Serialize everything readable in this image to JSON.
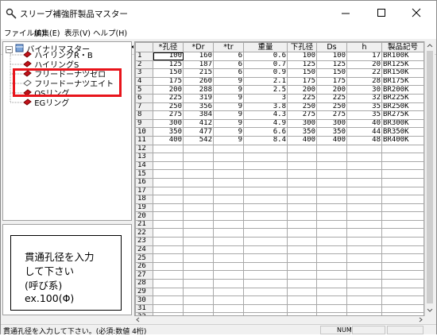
{
  "window": {
    "title": "スリーブ補強肝製品マスター",
    "buttons": [
      "minimize-button",
      "maximize-button",
      "close-button"
    ]
  },
  "menu": [
    {
      "label": "ファイル(F)"
    },
    {
      "label": "編集(E)"
    },
    {
      "label": "表示(V)"
    },
    {
      "label": "ヘルプ(H)"
    }
  ],
  "toolbar": {
    "icons": [
      "open-icon",
      "save-icon",
      "undo-icon",
      "redo-icon",
      "cut-icon",
      "copy-icon",
      "paste-icon",
      "insert-row-icon",
      "delete-row-icon",
      "help-icon"
    ]
  },
  "tree": {
    "root": {
      "label": "バイナリマスター",
      "expander": "−"
    },
    "items": [
      {
        "label": "ハイリングR・B"
      },
      {
        "label": "ハイリングS"
      },
      {
        "label": "フリードーナツゼロ"
      },
      {
        "label": "フリードーナツエイト"
      },
      {
        "label": "OSリング"
      },
      {
        "label": "EGリング"
      }
    ]
  },
  "info": {
    "lines": [
      "貫通孔径を入力",
      "して下さい",
      "(呼び系)",
      "ex.100(Φ)"
    ]
  },
  "grid": {
    "columns": [
      "*孔径",
      "*Dr",
      "*tr",
      "重量",
      "下孔径",
      "Ds",
      "h",
      "製品記号"
    ],
    "rows": [
      [
        "100",
        "160",
        "6",
        "0.6",
        "100",
        "100",
        "17",
        "BR100K"
      ],
      [
        "125",
        "187",
        "6",
        "0.7",
        "125",
        "125",
        "20",
        "BR125K"
      ],
      [
        "150",
        "215",
        "6",
        "0.9",
        "150",
        "150",
        "22",
        "BR150K"
      ],
      [
        "175",
        "260",
        "9",
        "2.1",
        "175",
        "175",
        "28",
        "BR175K"
      ],
      [
        "200",
        "288",
        "9",
        "2.5",
        "200",
        "200",
        "30",
        "BR200K"
      ],
      [
        "225",
        "319",
        "9",
        "3",
        "225",
        "225",
        "32",
        "BR225K"
      ],
      [
        "250",
        "356",
        "9",
        "3.8",
        "250",
        "250",
        "35",
        "BR250K"
      ],
      [
        "275",
        "384",
        "9",
        "4.3",
        "275",
        "275",
        "35",
        "BR275K"
      ],
      [
        "300",
        "412",
        "9",
        "4.9",
        "300",
        "300",
        "40",
        "BR300K"
      ],
      [
        "350",
        "477",
        "9",
        "6.6",
        "350",
        "350",
        "44",
        "BR350K"
      ],
      [
        "400",
        "542",
        "9",
        "8.4",
        "400",
        "400",
        "48",
        "BR400K"
      ]
    ],
    "row_numbers": [
      "1",
      "2",
      "3",
      "4",
      "5",
      "6",
      "7",
      "8",
      "9",
      "10",
      "11",
      "12",
      "13",
      "14",
      "15",
      "16",
      "17",
      "18",
      "19",
      "20",
      "21",
      "22",
      "23",
      "24",
      "25",
      "26",
      "27",
      "28",
      "29",
      "30",
      "31",
      "32"
    ]
  },
  "status": {
    "message": "貫通孔径を入力して下さい。(必須:数値 4桁)",
    "num": "NUM"
  }
}
